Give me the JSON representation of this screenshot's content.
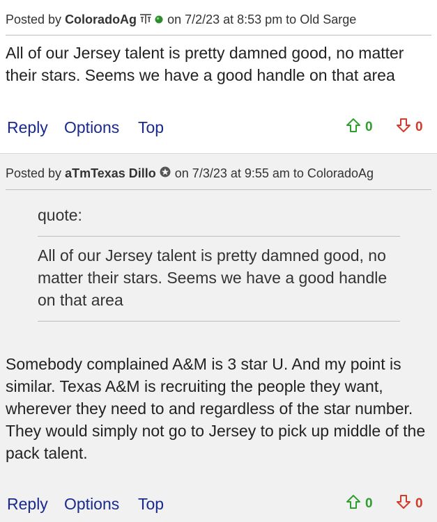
{
  "posts": [
    {
      "posted_by": "Posted by",
      "username": "ColoradoAg",
      "badge_icon": "aggie-logo-icon",
      "status_icon": "online-dot-icon",
      "meta": "on 7/2/23 at 8:53 pm to Old Sarge",
      "body": "All of our Jersey talent is pretty damned good, no matter their stars. Seems we have a good handle on that area",
      "actions": {
        "reply": "Reply",
        "options": "Options",
        "top": "Top"
      },
      "upvotes": "0",
      "downvotes": "0"
    },
    {
      "posted_by": "Posted by",
      "username": "aTmTexas Dillo",
      "badge_icon": "star-badge-icon",
      "meta": "on 7/3/23 at 9:55 am to ColoradoAg",
      "quote_label": "quote:",
      "quote_text": "All of our Jersey talent is pretty damned good, no matter their stars. Seems we have a good handle on that area",
      "body": "Somebody complained A&M is 3 star U. And my point is similar. Texas A&M is recruiting the people they want, wherever they need to and regardless of the star number. They would simply not go to Jersey to pick up middle of the pack talent.",
      "actions": {
        "reply": "Reply",
        "options": "Options",
        "top": "Top"
      },
      "upvotes": "0",
      "downvotes": "0"
    }
  ],
  "colors": {
    "link": "#1a2a8c",
    "upvote": "#2e9e2e",
    "downvote": "#d43a2a",
    "post_alt_bg": "#f1f1f1"
  }
}
